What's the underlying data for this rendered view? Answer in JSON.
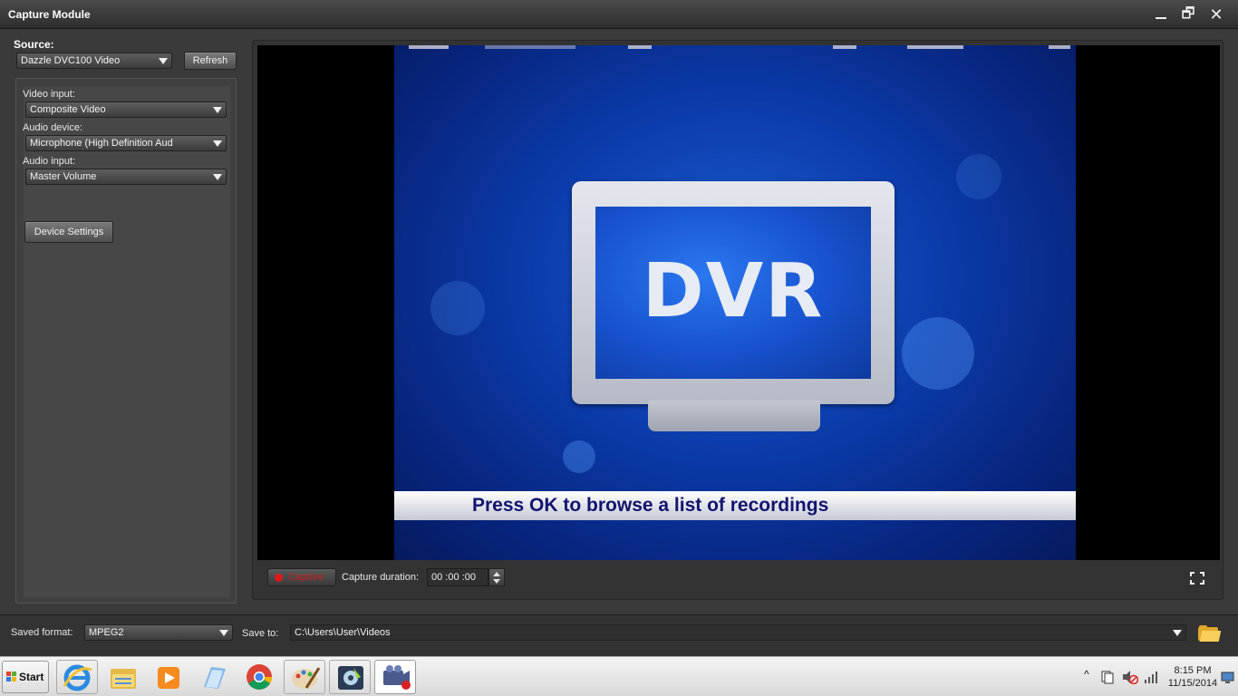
{
  "window": {
    "title": "Capture Module",
    "minimize_icon": "minimize-icon",
    "restore_icon": "restore-icon",
    "restore_glyph": "🗗",
    "close_icon": "close-icon",
    "close_glyph": "✕"
  },
  "source": {
    "label": "Source:",
    "selected": "Dazzle DVC100 Video",
    "refresh_label": "Refresh"
  },
  "settings": {
    "video_input_label": "Video input:",
    "video_input_value": "Composite Video",
    "audio_device_label": "Audio device:",
    "audio_device_value": "Microphone (High Definition Aud",
    "audio_input_label": "Audio input:",
    "audio_input_value": "Master Volume",
    "device_settings_label": "Device Settings"
  },
  "preview": {
    "tv_text": "DVR",
    "osd_text": "Press OK to browse a list of recordings"
  },
  "capture": {
    "capture_label": "Capture",
    "duration_label": "Capture duration:",
    "duration_value": "00 :00 :00",
    "fullscreen_icon": "fullscreen-icon"
  },
  "output": {
    "format_label": "Saved format:",
    "format_value": "MPEG2",
    "save_to_label": "Save to:",
    "save_to_value": "C:\\Users\\User\\Videos",
    "browse_icon": "folder-icon"
  },
  "taskbar": {
    "start_label": "Start",
    "items": [
      "internet-explorer-icon",
      "file-explorer-icon",
      "media-player-icon",
      "notepad-icon",
      "chrome-icon",
      "paint-icon",
      "media-center-icon",
      "capture-app-icon"
    ],
    "time": "8:15 PM",
    "date": "11/15/2014"
  },
  "colors": {
    "accent_capture": "#e01818",
    "panel": "#3a3a3a",
    "titlebar": "#2e2e2e"
  }
}
